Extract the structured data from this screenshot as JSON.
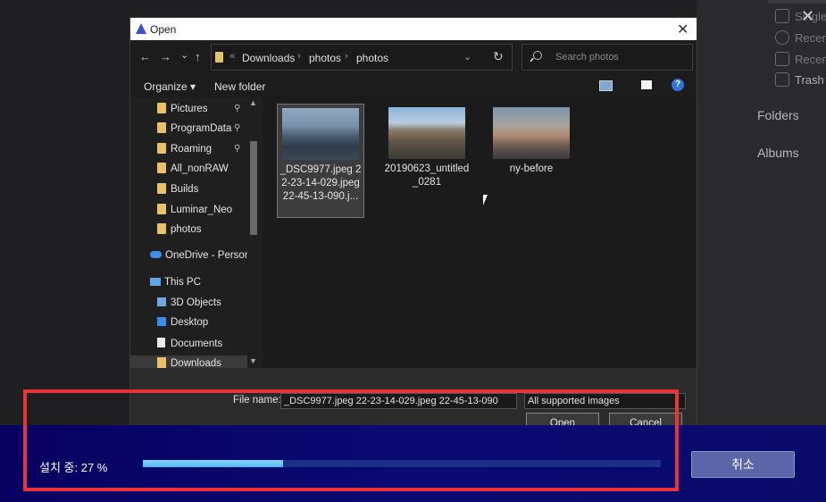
{
  "background_app": {
    "items": [
      "Single",
      "Recent",
      "Recent",
      "Trash"
    ],
    "nav": [
      "Folders",
      "Albums"
    ],
    "close_glyph": "✕"
  },
  "dialog": {
    "title": "Open",
    "close_glyph": "✕",
    "nav_buttons": {
      "back": "←",
      "forward": "→",
      "dropdown": "⌄",
      "up": "↑"
    },
    "breadcrumb": [
      "Downloads",
      "photos",
      "photos"
    ],
    "breadcrumb_prefix": "«",
    "breadcrumb_sep": "›",
    "address_dropdown": "⌄",
    "refresh": "↻",
    "search_placeholder": "Search photos",
    "toolbar": {
      "organize": "Organize ▾",
      "new_folder": "New folder",
      "help": "?"
    },
    "sidebar": [
      {
        "label": "Pictures",
        "pinned": true
      },
      {
        "label": "ProgramData",
        "pinned": true
      },
      {
        "label": "Roaming",
        "pinned": true
      },
      {
        "label": "All_nonRAW"
      },
      {
        "label": "Builds"
      },
      {
        "label": "Luminar_Neo"
      },
      {
        "label": "photos"
      },
      {
        "label": "OneDrive - Personal"
      },
      {
        "label": "This PC"
      },
      {
        "label": "3D Objects"
      },
      {
        "label": "Desktop"
      },
      {
        "label": "Documents"
      },
      {
        "label": "Downloads"
      }
    ],
    "pin_glyph": "📌",
    "files": [
      {
        "name": "_DSC9977.jpeg 22-23-14-029.jpeg 22-45-13-090.j...",
        "selected": true
      },
      {
        "name": "20190623_untitled_0281",
        "selected": false
      },
      {
        "name": "ny-before",
        "selected": false
      }
    ],
    "file_name_label": "File name:",
    "file_name_value": "_DSC9977.jpeg 22-23-14-029.jpeg 22-45-13-090",
    "file_type": "All supported images",
    "open_button": "Open",
    "cancel_button": "Cancel"
  },
  "installer": {
    "status_text": "설치 중: 27 %",
    "progress": 0.27,
    "cancel_label": "취소",
    "progress_color": "#5ec2f4",
    "bg_color": "#0b0a73"
  },
  "highlight_color": "#e8333a"
}
